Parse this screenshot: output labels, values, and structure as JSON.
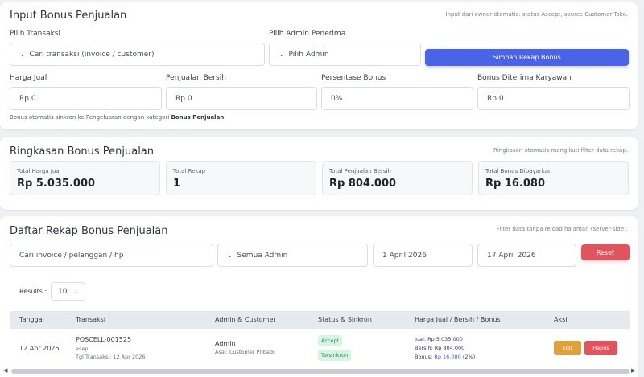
{
  "input_section": {
    "title": "Input Bonus Penjualan",
    "note": "Input dari owner otomatis: status Accept, source Customer Toko.",
    "transaksi_label": "Pilih Transaksi",
    "transaksi_placeholder": "Cari transaksi (invoice / customer)",
    "admin_label": "Pilih Admin Penerima",
    "admin_placeholder": "Pilih Admin",
    "save_button": "Simpan Rekap Bonus",
    "harga_jual_label": "Harga Jual",
    "harga_jual_value": "Rp 0",
    "penjualan_bersih_label": "Penjualan Bersih",
    "penjualan_bersih_value": "Rp 0",
    "persentase_label": "Persentase Bonus",
    "persentase_value": "0%",
    "bonus_diterima_label": "Bonus Diterima Karyawan",
    "bonus_diterima_value": "Rp 0",
    "sync_note_prefix": "Bonus otomatis sinkron ke Pengeluaran dengan kategori ",
    "sync_note_bold": "Bonus Penjualan",
    "sync_note_suffix": "."
  },
  "summary_section": {
    "title": "Ringkasan Bonus Penjualan",
    "note": "Ringkasan otomatis mengikuti filter data rekap.",
    "stats": [
      {
        "label": "Total Harga Jual",
        "value": "Rp 5.035.000"
      },
      {
        "label": "Total Rekap",
        "value": "1"
      },
      {
        "label": "Total Penjualan Bersih",
        "value": "Rp 804.000"
      },
      {
        "label": "Total Bonus Dibayarkan",
        "value": "Rp 16.080"
      }
    ]
  },
  "list_section": {
    "title": "Daftar Rekap Bonus Penjualan",
    "note": "Filter data tanpa reload halaman (server-side).",
    "search_placeholder": "Cari invoice / pelanggan / hp",
    "admin_filter": "Semua Admin",
    "date_from": "1 April 2026",
    "date_to": "17 April 2026",
    "reset_button": "Reset",
    "results_label": "Results :",
    "results_value": "10",
    "columns": [
      "Tanggal",
      "Transaksi",
      "Admin & Customer",
      "Status & Sinkron",
      "Harga Jual / Bersih / Bonus",
      "Aksi"
    ],
    "rows": [
      {
        "tanggal": "12 Apr 2026",
        "invoice": "POSCELL-001525",
        "customer_name": "asep",
        "tgl_transaksi": "Tgl Transaksi: 12 Apr 2026",
        "admin": "Admin",
        "asal": "Asal: Customer Pribadi",
        "status": "Accept",
        "sinkron": "Tersinkron",
        "jual": "Jual: Rp 5.035.000",
        "bersih": "Bersih: Rp 804.000",
        "bonus_prefix": "Bonus: ",
        "bonus_value": "Rp 16.080",
        "bonus_pct": " (2%)",
        "edit_label": "Edit",
        "delete_label": "Hapus"
      }
    ]
  },
  "colors": {
    "primary": "#4a63e7",
    "danger": "#e0545e",
    "warning": "#e0a03a",
    "success_bg": "#d7f3e3",
    "success_text": "#2f8a55"
  },
  "icons": [
    "chevron-down-icon",
    "scroll-left-icon",
    "scroll-right-icon"
  ]
}
